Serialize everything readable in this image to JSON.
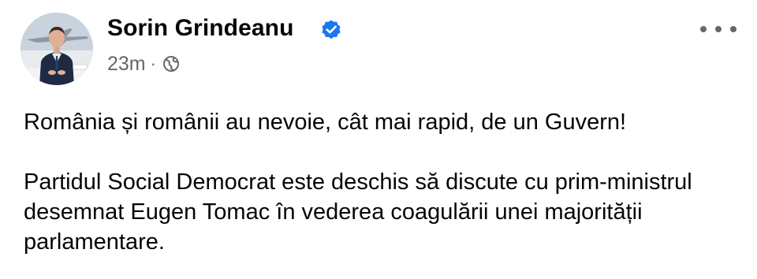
{
  "post": {
    "author": "Sorin Grindeanu",
    "time": "23m",
    "separator": "·",
    "audience_icon": "globe-icon",
    "verified_icon": "verified-badge-icon",
    "paragraphs": [
      "România și românii au nevoie, cât mai rapid, de un Guvern!",
      "Partidul Social Democrat este deschis să discute cu prim-ministrul desemnat Eugen Tomac în vederea coagulării unei majorității parlamentare."
    ]
  },
  "colors": {
    "verified_blue": "#1877f2",
    "meta_gray": "#65676b",
    "text": "#050505"
  }
}
